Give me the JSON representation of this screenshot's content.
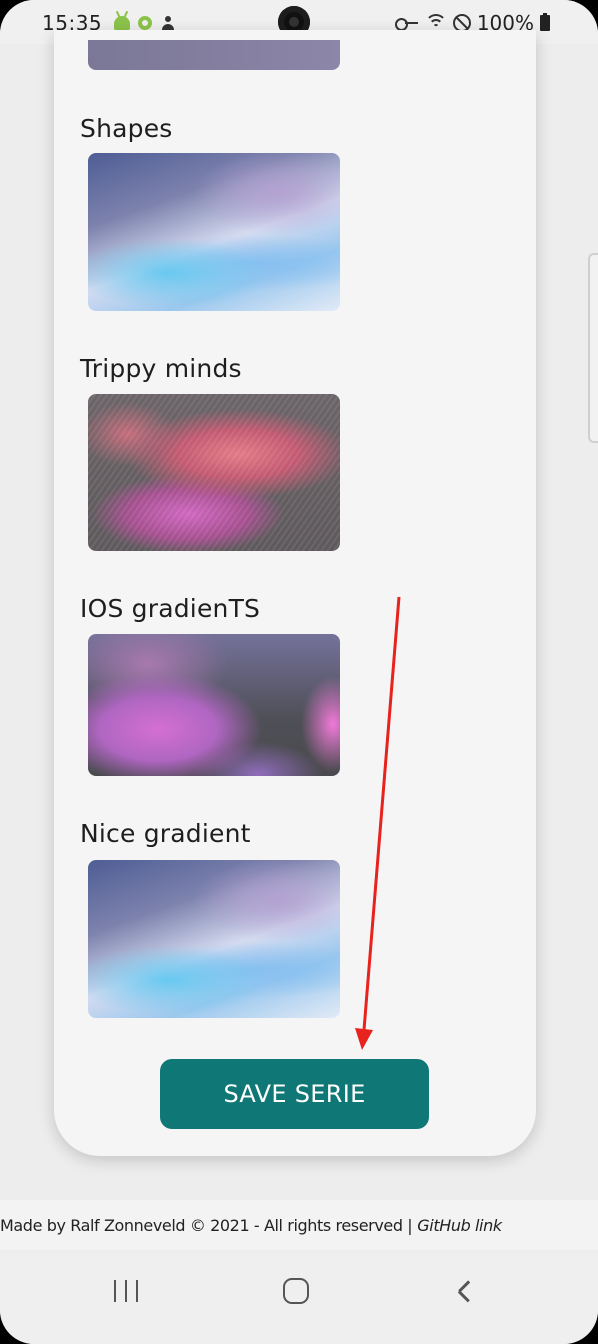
{
  "status_bar": {
    "time": "15:35",
    "battery": "100%"
  },
  "sections": [
    {
      "title": "Shapes"
    },
    {
      "title": "Trippy minds"
    },
    {
      "title": "IOS gradienTS"
    },
    {
      "title": "Nice gradient"
    }
  ],
  "save_button": {
    "label": "SAVE SERIE"
  },
  "footer": {
    "text": "Made by Ralf Zonneveld © 2021 - All rights reserved |",
    "link": "GitHub link"
  },
  "colors": {
    "accent": "#0f7776",
    "annotation": "#e8221d"
  }
}
